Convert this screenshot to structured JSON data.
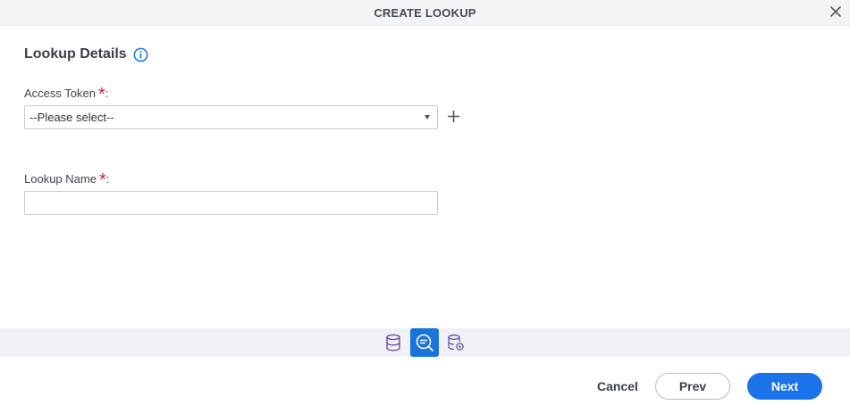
{
  "dialog": {
    "title": "CREATE LOOKUP"
  },
  "section": {
    "title": "Lookup Details"
  },
  "fields": {
    "access_token": {
      "label": "Access Token",
      "required_mark": "*",
      "colon": ":",
      "selected_value": "--Please select--"
    },
    "lookup_name": {
      "label": "Lookup Name",
      "required_mark": "*",
      "colon": ":",
      "value": ""
    }
  },
  "steps": [
    {
      "icon": "database-icon",
      "active": false
    },
    {
      "icon": "lookup-search-icon",
      "active": true
    },
    {
      "icon": "database-settings-icon",
      "active": false
    }
  ],
  "footer": {
    "cancel_label": "Cancel",
    "prev_label": "Prev",
    "next_label": "Next"
  },
  "colors": {
    "accent": "#1a73e8",
    "required": "#c62828",
    "step_active_bg": "#1a73d9",
    "step_icon": "#6b4fa0"
  }
}
